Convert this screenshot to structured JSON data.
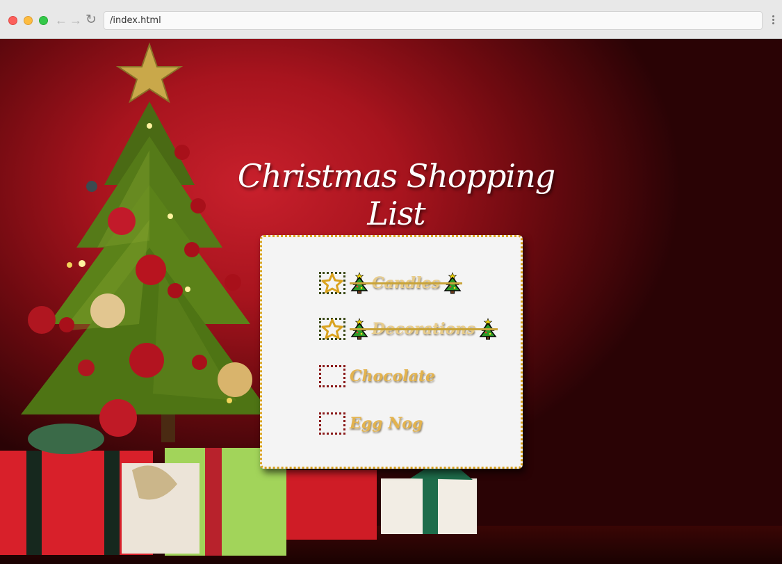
{
  "browser": {
    "address": "/index.html",
    "back_icon": "arrow-left-icon",
    "forward_icon": "arrow-right-icon",
    "reload_icon": "reload-icon",
    "menu_icon": "kebab-menu-icon"
  },
  "page": {
    "title": "Christmas Shopping List"
  },
  "shopping_list": {
    "items": [
      {
        "label": "Candles",
        "checked": true
      },
      {
        "label": "Decorations",
        "checked": true
      },
      {
        "label": "Chocolate",
        "checked": false
      },
      {
        "label": "Egg Nog",
        "checked": false
      }
    ]
  },
  "colors": {
    "card_border": "#d9a21e",
    "label_gold": "#e3b34e",
    "unchecked_border": "#8a1a1a",
    "checked_border": "#3c4a18",
    "background_red": "#a8141e"
  }
}
